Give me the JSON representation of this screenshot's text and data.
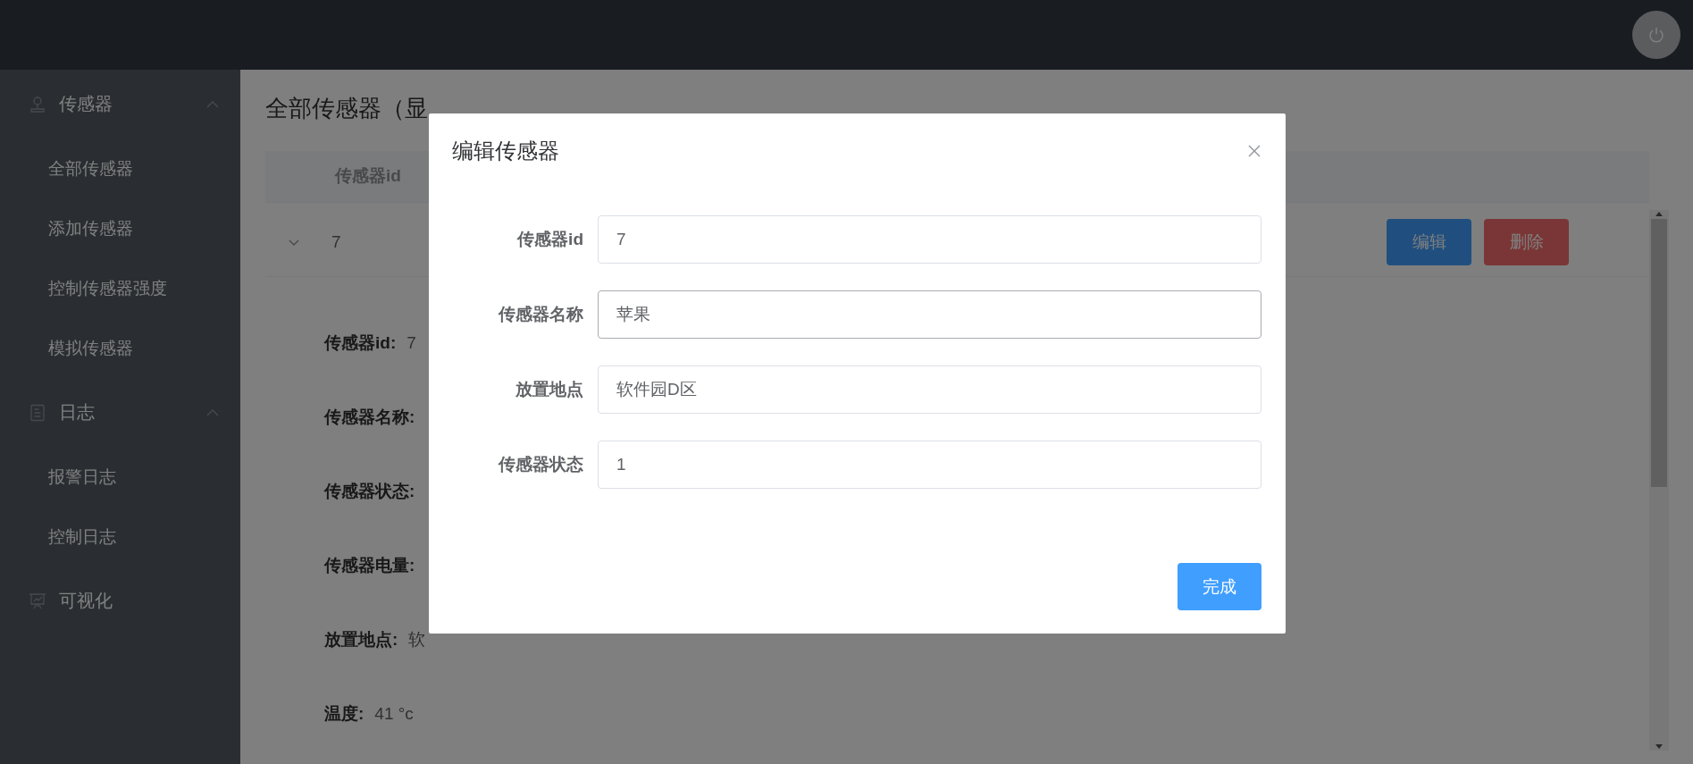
{
  "sidebar": {
    "groups": [
      {
        "label": "传感器",
        "expanded": true,
        "children": [
          {
            "label": "全部传感器"
          },
          {
            "label": "添加传感器"
          },
          {
            "label": "控制传感器强度"
          },
          {
            "label": "模拟传感器"
          }
        ]
      },
      {
        "label": "日志",
        "expanded": true,
        "children": [
          {
            "label": "报警日志"
          },
          {
            "label": "控制日志"
          }
        ]
      },
      {
        "label": "可视化"
      }
    ]
  },
  "page": {
    "title": "全部传感器（显",
    "table": {
      "columns": [
        "传感器id"
      ],
      "rows": [
        {
          "expanded": true,
          "cells": [
            "7"
          ],
          "actions": [
            {
              "label": "编辑",
              "kind": "primary"
            },
            {
              "label": "删除",
              "kind": "danger"
            }
          ]
        }
      ]
    },
    "details": [
      {
        "label": "传感器id:",
        "value": "7"
      },
      {
        "label": "传感器名称:"
      },
      {
        "label": "传感器状态:"
      },
      {
        "label": "传感器电量:"
      },
      {
        "label": "放置地点:",
        "value": "软"
      },
      {
        "label": "温度:",
        "value": "41 °c"
      }
    ]
  },
  "dialog": {
    "title": "编辑传感器",
    "fields": [
      {
        "label": "传感器id",
        "value": "7",
        "hovered": false
      },
      {
        "label": "传感器名称",
        "value": "苹果",
        "hovered": true
      },
      {
        "label": "放置地点",
        "value": "软件园D区",
        "hovered": false
      },
      {
        "label": "传感器状态",
        "value": "1",
        "hovered": false
      }
    ],
    "submit": "完成"
  }
}
